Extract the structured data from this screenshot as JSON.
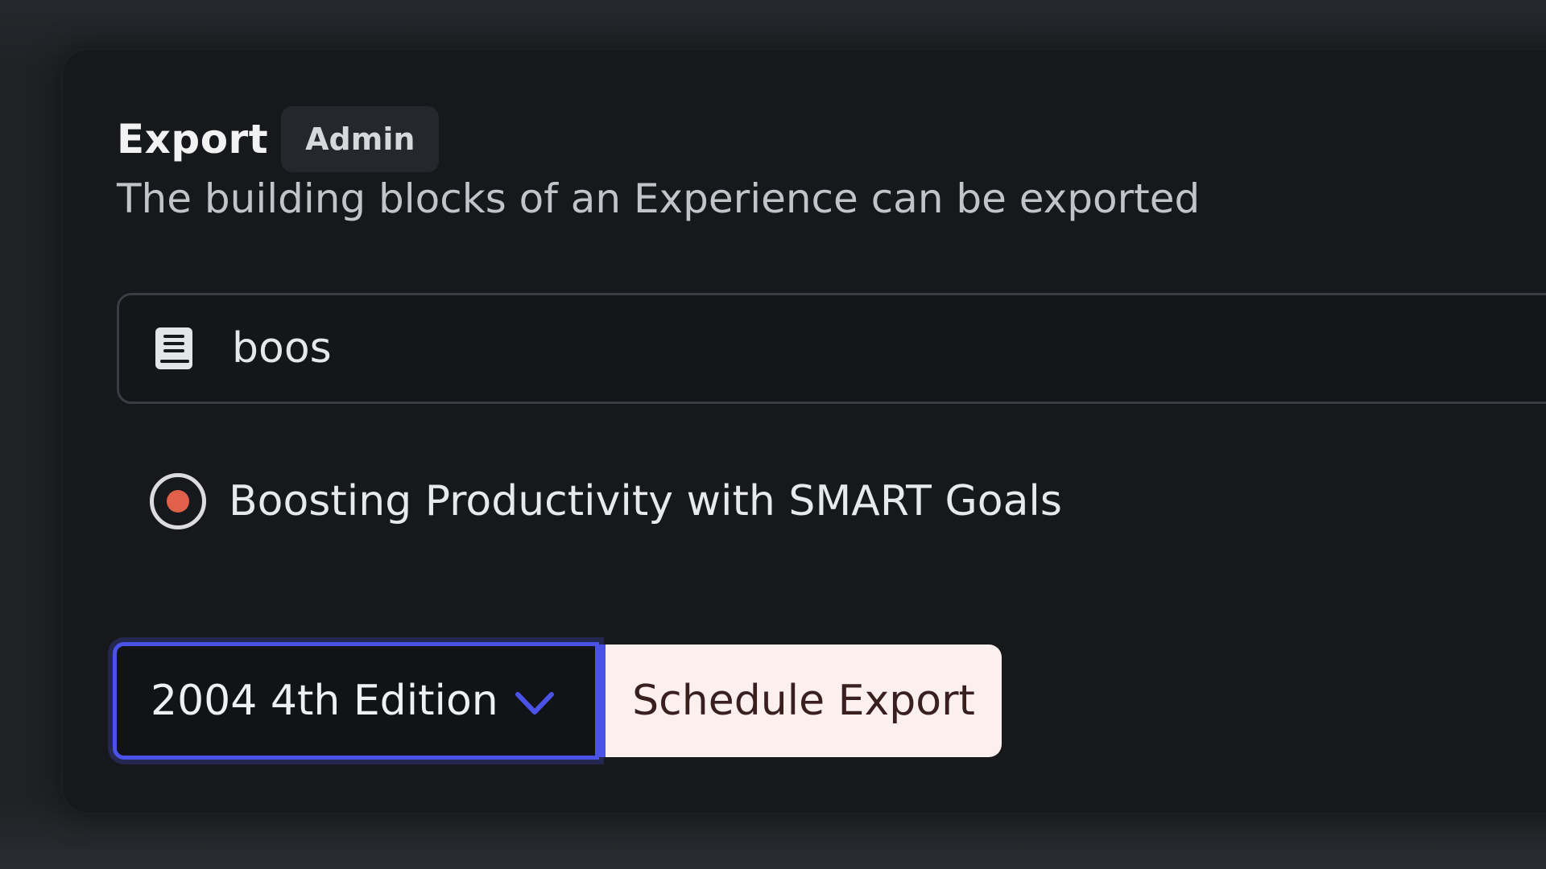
{
  "export": {
    "title": "Export",
    "badge": "Admin",
    "subtitle": "The building blocks of an Experience can be exported"
  },
  "search": {
    "icon": "book-icon",
    "value": "boos",
    "placeholder": ""
  },
  "results": [
    {
      "label": "Boosting Productivity with SMART Goals",
      "selected": true
    }
  ],
  "edition_select": {
    "value": "2004 4th Edition",
    "icon": "chevron-down-icon"
  },
  "actions": {
    "schedule_label": "Schedule Export"
  },
  "colors": {
    "accent": "#4a52e8",
    "radio_selected": "#e0604a",
    "button_bg": "#fbf0ee"
  }
}
